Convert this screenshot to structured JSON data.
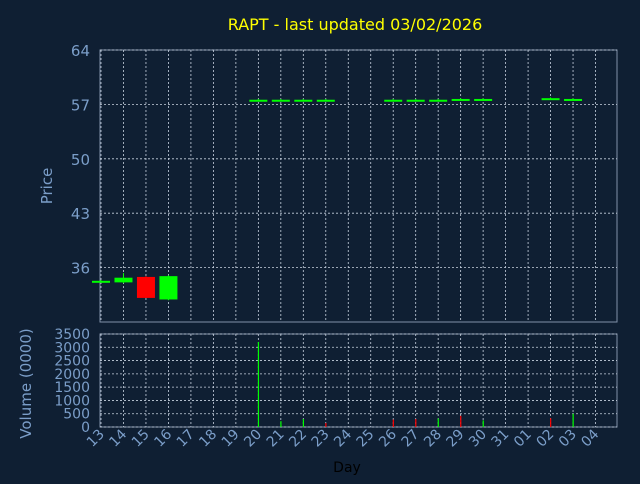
{
  "colors": {
    "background": "#0f1f33",
    "axis_text": "#7b9ec9",
    "title": "#ffff00",
    "grid": "#c8d2e0",
    "up": "#00ff00",
    "down": "#ff0000",
    "frame": "#8090a8"
  },
  "chart_data": {
    "type": "candlestick",
    "title": "RAPT - last updated 03/02/2026",
    "xlabel": "Day",
    "x_ticks": [
      "13",
      "14",
      "15",
      "16",
      "17",
      "18",
      "19",
      "20",
      "21",
      "22",
      "23",
      "24",
      "25",
      "26",
      "27",
      "28",
      "29",
      "30",
      "31",
      "01",
      "02",
      "03",
      "04"
    ],
    "grid": true,
    "price_panel": {
      "ylabel": "Price",
      "ylim": [
        29,
        64
      ],
      "y_ticks": [
        36,
        43,
        50,
        57,
        64
      ],
      "candles": [
        {
          "day": "13",
          "open": 34.3,
          "high": 34.4,
          "low": 34.2,
          "close": 34.3
        },
        {
          "day": "14",
          "open": 34.1,
          "high": 35.3,
          "low": 34.0,
          "close": 34.7
        },
        {
          "day": "15",
          "open": 34.8,
          "high": 34.9,
          "low": 32.1,
          "close": 32.1
        },
        {
          "day": "16",
          "open": 31.9,
          "high": 35.0,
          "low": 31.8,
          "close": 34.9
        },
        {
          "day": "20",
          "open": 57.6,
          "high": 57.7,
          "low": 57.5,
          "close": 57.6
        },
        {
          "day": "21",
          "open": 57.6,
          "high": 57.7,
          "low": 57.5,
          "close": 57.6
        },
        {
          "day": "22",
          "open": 57.6,
          "high": 57.7,
          "low": 57.5,
          "close": 57.6
        },
        {
          "day": "23",
          "open": 57.6,
          "high": 57.7,
          "low": 57.5,
          "close": 57.6
        },
        {
          "day": "26",
          "open": 57.6,
          "high": 57.7,
          "low": 57.5,
          "close": 57.6
        },
        {
          "day": "27",
          "open": 57.6,
          "high": 57.7,
          "low": 57.5,
          "close": 57.6
        },
        {
          "day": "28",
          "open": 57.6,
          "high": 57.7,
          "low": 57.5,
          "close": 57.6
        },
        {
          "day": "29",
          "open": 57.7,
          "high": 57.8,
          "low": 57.6,
          "close": 57.7
        },
        {
          "day": "30",
          "open": 57.7,
          "high": 57.8,
          "low": 57.6,
          "close": 57.7
        },
        {
          "day": "02",
          "open": 57.8,
          "high": 57.9,
          "low": 57.7,
          "close": 57.8
        },
        {
          "day": "03",
          "open": 57.7,
          "high": 57.8,
          "low": 57.6,
          "close": 57.7
        }
      ]
    },
    "volume_panel": {
      "ylabel": "Volume (0000)",
      "ylim": [
        0,
        3500
      ],
      "y_ticks": [
        0,
        500,
        1000,
        1500,
        2000,
        2500,
        3000,
        3500
      ],
      "bars": [
        {
          "day": "20",
          "value": 3200,
          "direction": "up"
        },
        {
          "day": "21",
          "value": 220,
          "direction": "up"
        },
        {
          "day": "22",
          "value": 300,
          "direction": "up"
        },
        {
          "day": "23",
          "value": 150,
          "direction": "down"
        },
        {
          "day": "26",
          "value": 280,
          "direction": "down"
        },
        {
          "day": "27",
          "value": 300,
          "direction": "down"
        },
        {
          "day": "28",
          "value": 320,
          "direction": "up"
        },
        {
          "day": "29",
          "value": 420,
          "direction": "down"
        },
        {
          "day": "30",
          "value": 250,
          "direction": "up"
        },
        {
          "day": "02",
          "value": 330,
          "direction": "down"
        },
        {
          "day": "03",
          "value": 500,
          "direction": "up"
        }
      ]
    }
  }
}
